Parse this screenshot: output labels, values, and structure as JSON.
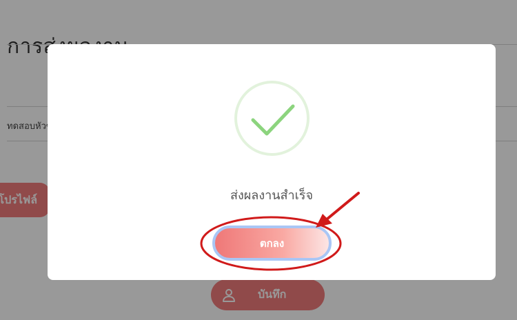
{
  "background": {
    "page_title": "การส่งผลงาน",
    "field_value": "ทดสอบหัวข้อ",
    "profile_button": "โปรไฟล์",
    "save_button": "บันทึก"
  },
  "modal": {
    "icon": "check-icon",
    "message": "ส่งผลงานสำเร็จ",
    "ok_button": "ตกลง"
  },
  "annotation": {
    "highlight": "red-ellipse-around-ok-button",
    "arrow": "red-arrow-pointing-to-ok-button"
  },
  "colors": {
    "overlay": "#000000",
    "success_green": "#8cd47e",
    "success_ring": "#e2f2dc",
    "button_red": "#ef7878",
    "focus_ring": "#a9c6f5",
    "annotation_red": "#d01a1a"
  }
}
